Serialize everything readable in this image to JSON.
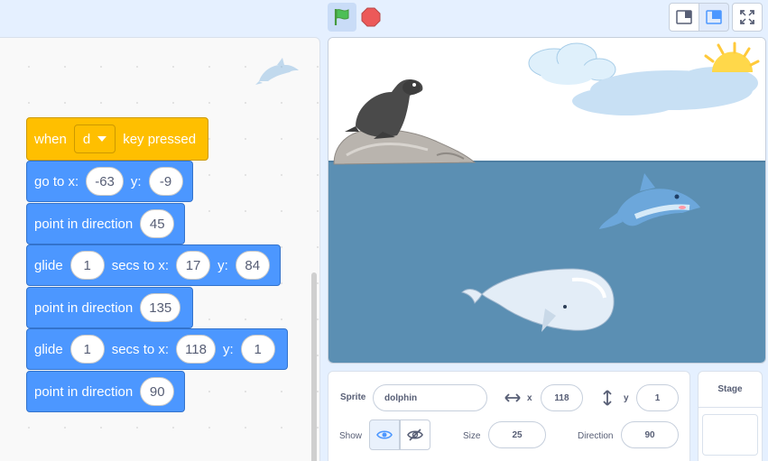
{
  "blocks": {
    "hat": {
      "when": "when",
      "key": "d",
      "pressed": "key pressed"
    },
    "b1": {
      "text": "go to x:",
      "x": "-63",
      "ylabel": "y:",
      "y": "-9"
    },
    "b2": {
      "text": "point in direction",
      "value": "45"
    },
    "b3": {
      "text": "glide",
      "secs": "1",
      "mid": "secs to x:",
      "x": "17",
      "ylabel": "y:",
      "y": "84"
    },
    "b4": {
      "text": "point in direction",
      "value": "135"
    },
    "b5": {
      "text": "glide",
      "secs": "1",
      "mid": "secs to x:",
      "x": "118",
      "ylabel": "y:",
      "y": "1"
    },
    "b6": {
      "text": "point in direction",
      "value": "90"
    }
  },
  "sprite_info": {
    "sprite_label": "Sprite",
    "sprite_name": "dolphin",
    "x_label": "x",
    "x": "118",
    "y_label": "y",
    "y": "1",
    "show_label": "Show",
    "size_label": "Size",
    "size": "25",
    "direction_label": "Direction",
    "direction": "90"
  },
  "stage_panel": {
    "title": "Stage"
  },
  "icons": [
    "green-flag-icon",
    "stop-icon",
    "small-stage-icon",
    "normal-stage-icon",
    "fullscreen-icon",
    "eye-icon",
    "eye-off-icon",
    "x-arrows-icon",
    "y-arrows-icon"
  ],
  "colors": {
    "motion": "#4c97ff",
    "event": "#ffbf00",
    "water": "#5b8fb3"
  }
}
